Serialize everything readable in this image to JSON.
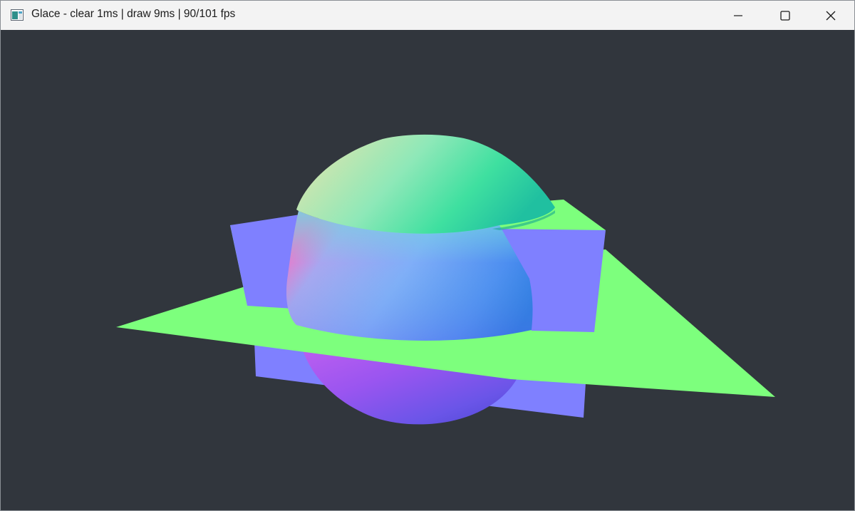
{
  "window": {
    "title": "Glace - clear 1ms | draw 9ms | 90/101 fps",
    "controls": {
      "minimize": "minimize-icon",
      "maximize": "maximize-icon",
      "close": "close-icon"
    }
  },
  "scene": {
    "background_color": "#31363d",
    "plane_color": "#7dff7d",
    "box_side_color": "#7f80ff",
    "sphere_shading": "normal-colored"
  }
}
